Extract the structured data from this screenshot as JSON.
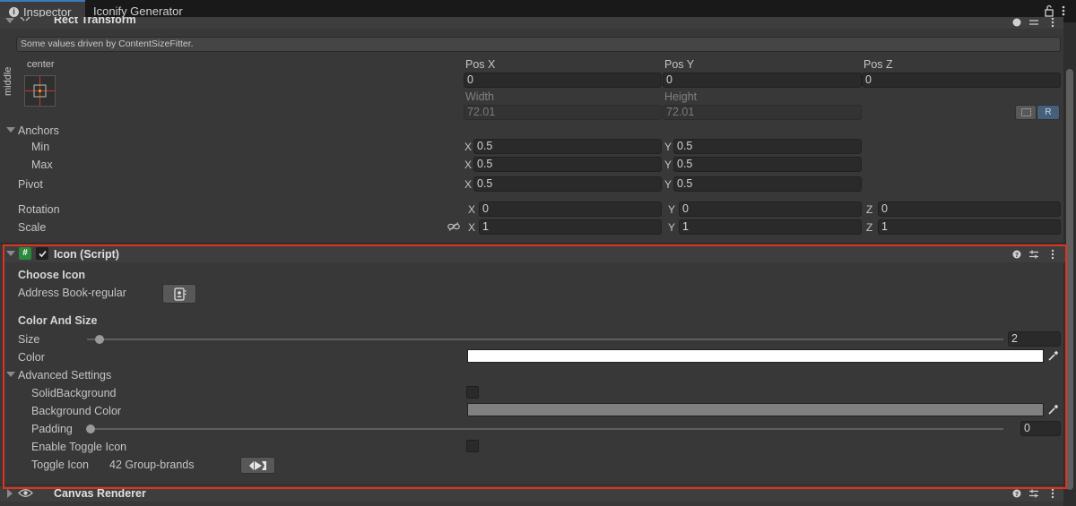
{
  "tabs": [
    {
      "label": "Inspector"
    },
    {
      "label": "Iconify Generator"
    }
  ],
  "rect_transform": {
    "title": "Rect Transform",
    "help_text": "Some values driven by ContentSizeFitter.",
    "anchor_preset_h": "center",
    "anchor_preset_v": "middle",
    "pos_x_label": "Pos X",
    "pos_y_label": "Pos Y",
    "pos_z_label": "Pos Z",
    "pos_x": "0",
    "pos_y": "0",
    "pos_z": "0",
    "width_label": "Width",
    "height_label": "Height",
    "width": "72.01",
    "height": "72.01",
    "raw_button": "R",
    "anchors_label": "Anchors",
    "min_label": "Min",
    "max_label": "Max",
    "min_x": "0.5",
    "min_y": "0.5",
    "max_x": "0.5",
    "max_y": "0.5",
    "pivot_label": "Pivot",
    "pivot_x": "0.5",
    "pivot_y": "0.5",
    "rotation_label": "Rotation",
    "rot_x": "0",
    "rot_y": "0",
    "rot_z": "0",
    "scale_label": "Scale",
    "scale_x": "1",
    "scale_y": "1",
    "scale_z": "1",
    "axis_x": "X",
    "axis_y": "Y",
    "axis_z": "Z"
  },
  "icon_script": {
    "title": "Icon (Script)",
    "choose_icon_header": "Choose Icon",
    "icon_name": "Address Book-regular",
    "color_size_header": "Color And Size",
    "size_label": "Size",
    "size_value": "2",
    "size_fraction": 0.006,
    "color_label": "Color",
    "color_value": "#ffffff",
    "advanced_label": "Advanced Settings",
    "solid_bg_label": "SolidBackground",
    "bg_color_label": "Background Color",
    "bg_color_value": "#808080",
    "padding_label": "Padding",
    "padding_value": "0",
    "padding_fraction": 0.0,
    "enable_toggle_label": "Enable Toggle Icon",
    "toggle_icon_label": "Toggle Icon",
    "toggle_icon_name": "42 Group-brands"
  },
  "canvas_renderer": {
    "title": "Canvas Renderer"
  },
  "colors": {
    "highlight": "#e0321e",
    "accent_tab": "#3a79bb"
  }
}
